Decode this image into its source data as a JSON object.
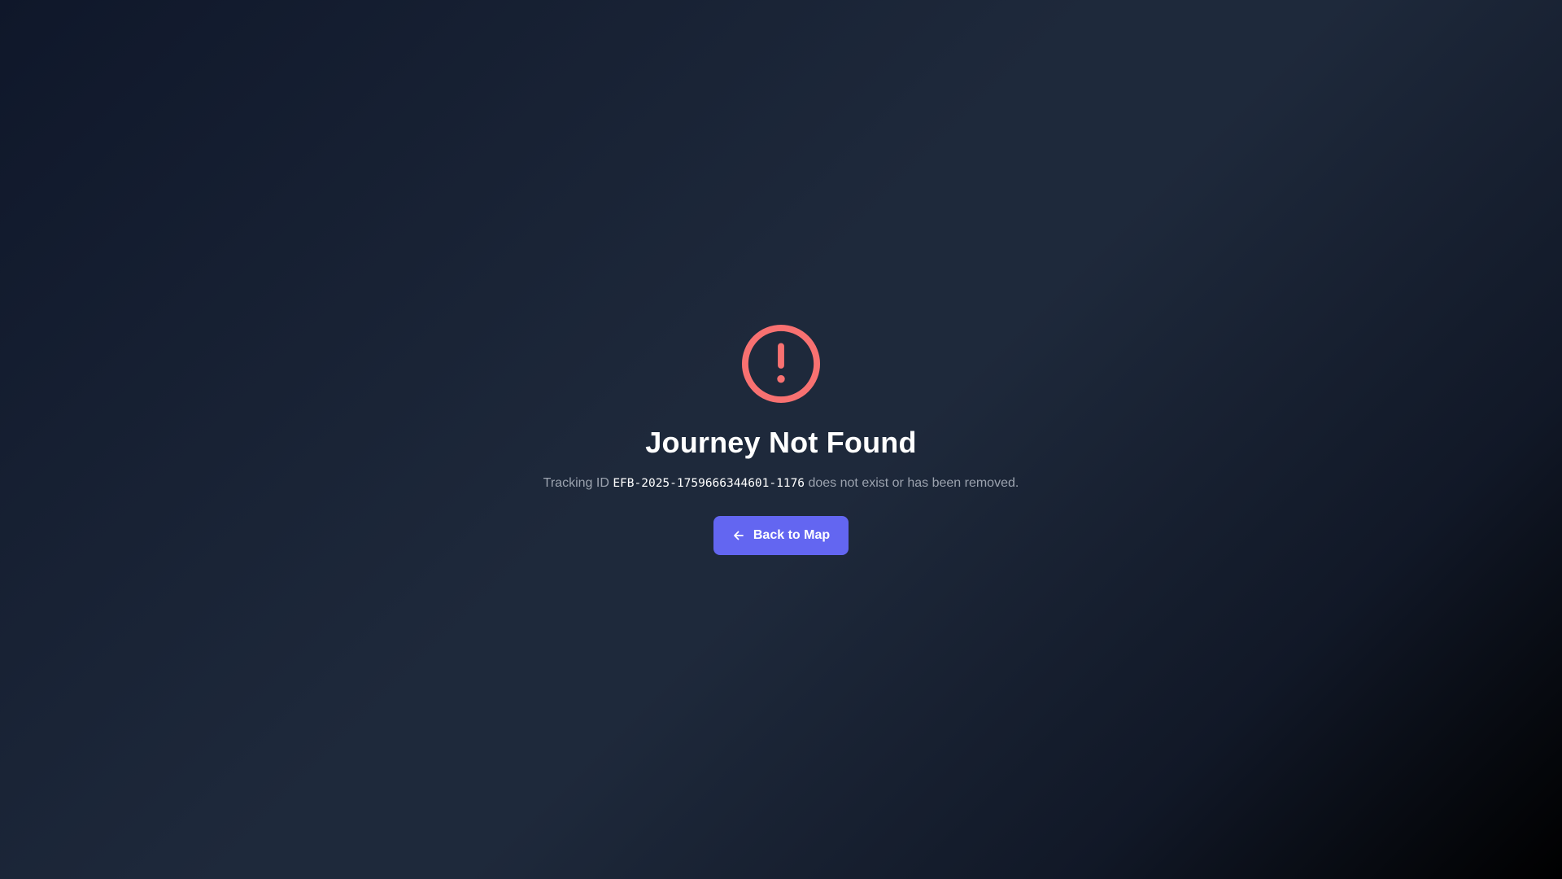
{
  "error": {
    "title": "Journey Not Found",
    "message_prefix": "Tracking ID",
    "tracking_id": "EFB-2025-1759666344601-1176",
    "message_suffix": "does not exist or has been removed."
  },
  "actions": {
    "back_label": "Back to Map"
  },
  "icons": {
    "alert": "alert-circle-icon",
    "back": "arrow-left-icon"
  },
  "colors": {
    "alert": "#f87171",
    "button": "#6366f1",
    "title": "#ffffff",
    "message": "#9ca3af"
  }
}
